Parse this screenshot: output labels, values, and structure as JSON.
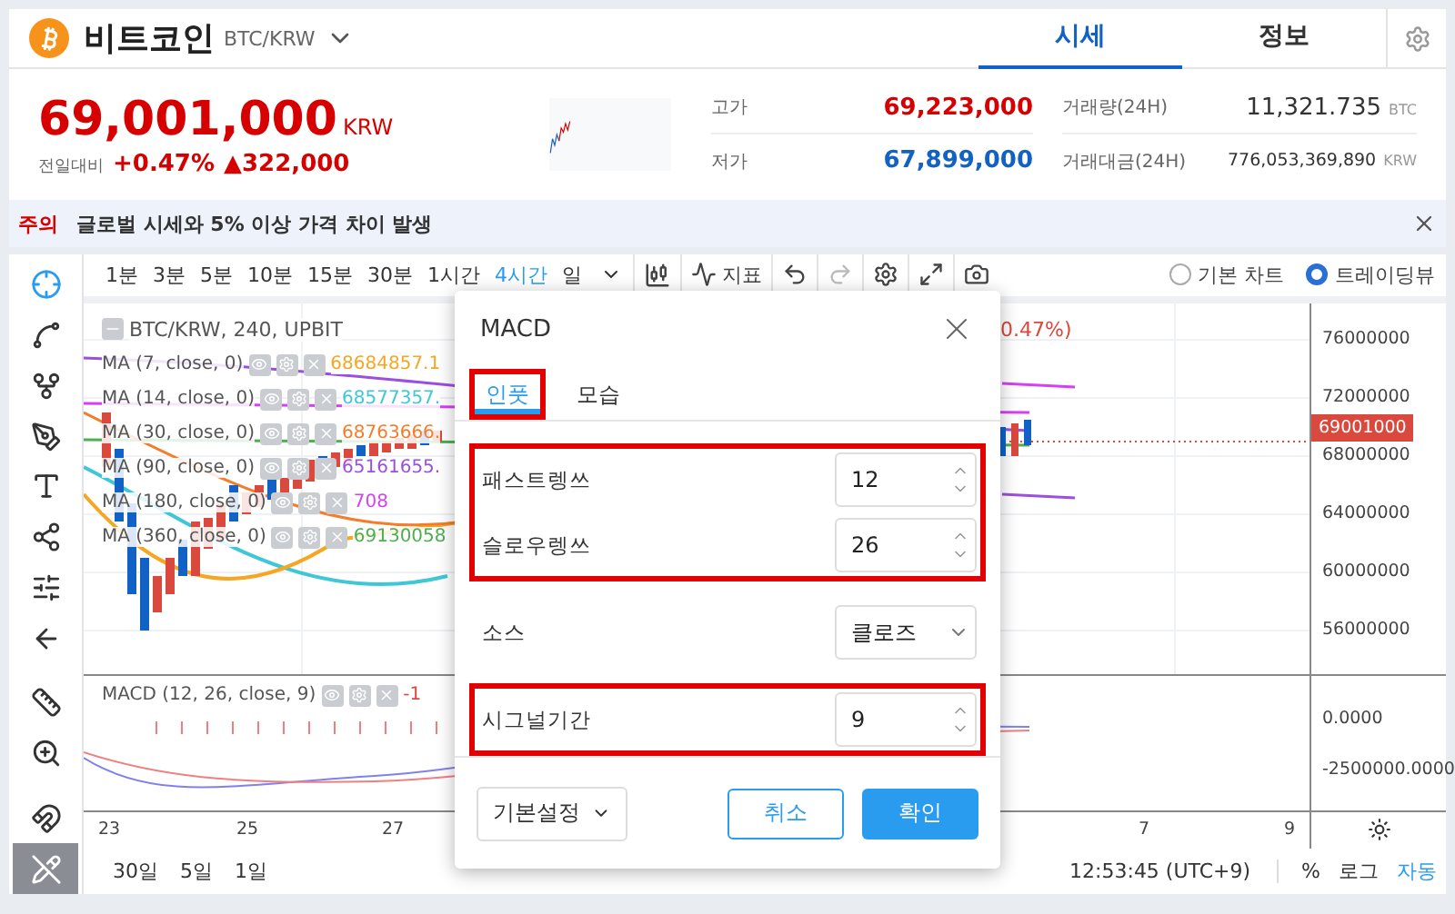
{
  "coin": {
    "name": "비트코인",
    "pair": "BTC/KRW"
  },
  "tabs": [
    {
      "label": "시세",
      "selected": true
    },
    {
      "label": "정보",
      "selected": false
    }
  ],
  "price": {
    "value": "69,001,000",
    "unit": "KRW",
    "change_label": "전일대비",
    "change_pct": "+0.47%",
    "change_abs": "▲322,000"
  },
  "stats": [
    {
      "kind": "price",
      "label": "고가",
      "value": "69,223,000",
      "color": "#d60000"
    },
    {
      "kind": "volume",
      "label": "거래량(24H)",
      "value": "11,321.735",
      "unit": "BTC"
    },
    {
      "kind": "price",
      "label": "저가",
      "value": "67,899,000",
      "color": "#1261c4"
    },
    {
      "kind": "amount",
      "label": "거래대금(24H)",
      "value": "776,053,369,890",
      "unit": "KRW"
    }
  ],
  "notice": {
    "tag": "주의",
    "text": "글로벌 시세와 5% 이상 가격 차이 발생"
  },
  "tools": [
    {
      "selected": true
    },
    {
      "selected": false
    },
    {
      "selected": false
    },
    {
      "selected": false
    },
    {
      "selected": false
    },
    {
      "selected": false
    },
    {
      "selected": false
    },
    {
      "selected": false
    },
    {
      "selected": false
    },
    {
      "selected": false
    },
    {
      "selected": false
    },
    {
      "selected": false
    }
  ],
  "intervals": [
    {
      "label": "1분",
      "selected": false
    },
    {
      "label": "3분",
      "selected": false
    },
    {
      "label": "5분",
      "selected": false
    },
    {
      "label": "10분",
      "selected": false
    },
    {
      "label": "15분",
      "selected": false
    },
    {
      "label": "30분",
      "selected": false
    },
    {
      "label": "1시간",
      "selected": false
    },
    {
      "label": "4시간",
      "selected": true
    },
    {
      "label": "일",
      "selected": false
    }
  ],
  "indicator_button": "지표",
  "chart_modes": [
    {
      "label": "기본 차트",
      "selected": false
    },
    {
      "label": "트레이딩뷰",
      "selected": true
    }
  ],
  "legend": {
    "title": "BTC/KRW, 240, UPBIT",
    "change_tail": "0.47%)",
    "studies": [
      {
        "label": "MA (7, close, 0)",
        "value": "68684857.1",
        "color": "#f5a623"
      },
      {
        "label": "MA (14, close, 0)",
        "value": "68577357.",
        "color": "#3fc7d6"
      },
      {
        "label": "MA (30, close, 0)",
        "value": "68763666.",
        "color": "#f57c2a"
      },
      {
        "label": "MA (90, close, 0)",
        "value": "65161655.",
        "color": "#9b4fe0"
      },
      {
        "label": "MA (180, close, 0)",
        "value": "708",
        "color": "#d63ff5"
      },
      {
        "label": "MA (360, close, 0)",
        "value": "69130058",
        "color": "#4caf50"
      }
    ]
  },
  "macd_legend": {
    "label": "MACD (12, 26, close, 9)",
    "value": "-1"
  },
  "price_axis": [
    "76000000",
    "72000000",
    "68000000",
    "64000000",
    "60000000",
    "56000000"
  ],
  "last_price": "69001000",
  "macd_axis": [
    "0.0000",
    "-2500000.0000"
  ],
  "time_axis": [
    "23",
    "25",
    "27",
    "7",
    "9"
  ],
  "ranges": [
    "30일",
    "5일",
    "1일"
  ],
  "clock": "12:53:45 (UTC+9)",
  "scale_options": [
    "%",
    "로그",
    "자동"
  ],
  "dialog": {
    "title": "MACD",
    "tabs": [
      {
        "label": "인풋",
        "selected": true,
        "highlighted": true
      },
      {
        "label": "모습",
        "selected": false,
        "highlighted": false
      }
    ],
    "groups": [
      {
        "highlighted": true,
        "fields": [
          {
            "kind": "number",
            "label": "패스트렝쓰",
            "value": "12"
          },
          {
            "kind": "number",
            "label": "슬로우렝쓰",
            "value": "26"
          }
        ]
      },
      {
        "highlighted": false,
        "fields": [
          {
            "kind": "select",
            "label": "소스",
            "value": "클로즈"
          }
        ]
      },
      {
        "highlighted": true,
        "fields": [
          {
            "kind": "number",
            "label": "시그널기간",
            "value": "9"
          }
        ]
      }
    ],
    "defaults": "기본설정",
    "cancel": "취소",
    "ok": "확인"
  }
}
